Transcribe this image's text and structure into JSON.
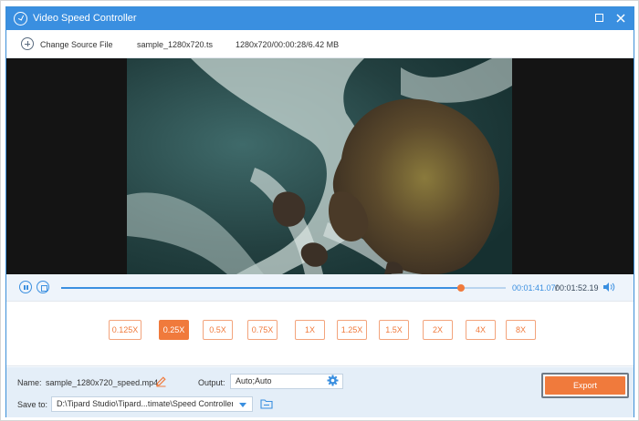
{
  "window": {
    "title": "Video Speed Controller",
    "accent_color": "#3a8fe0",
    "controls": [
      "maximize-icon",
      "close-icon"
    ]
  },
  "source": {
    "change_label": "Change Source File",
    "filename": "sample_1280x720.ts",
    "details": "1280x720/00:00:28/6.42 MB"
  },
  "player": {
    "current_time": "00:01:41.07",
    "separator": "/",
    "total_time": "00:01:52.19",
    "progress_percent": 90
  },
  "speed": {
    "options": [
      "0.125X",
      "0.25X",
      "0.5X",
      "0.75X",
      "1X",
      "1.25X",
      "1.5X",
      "2X",
      "4X",
      "8X"
    ],
    "selected": "0.25X",
    "accent_color": "#f07a3c"
  },
  "output": {
    "name_label": "Name:",
    "name_value": "sample_1280x720_speed.mp4",
    "output_label": "Output:",
    "output_value": "Auto;Auto",
    "save_label": "Save to:",
    "save_path": "D:\\Tipard Studio\\Tipard...timate\\Speed Controller",
    "export_label": "Export"
  }
}
